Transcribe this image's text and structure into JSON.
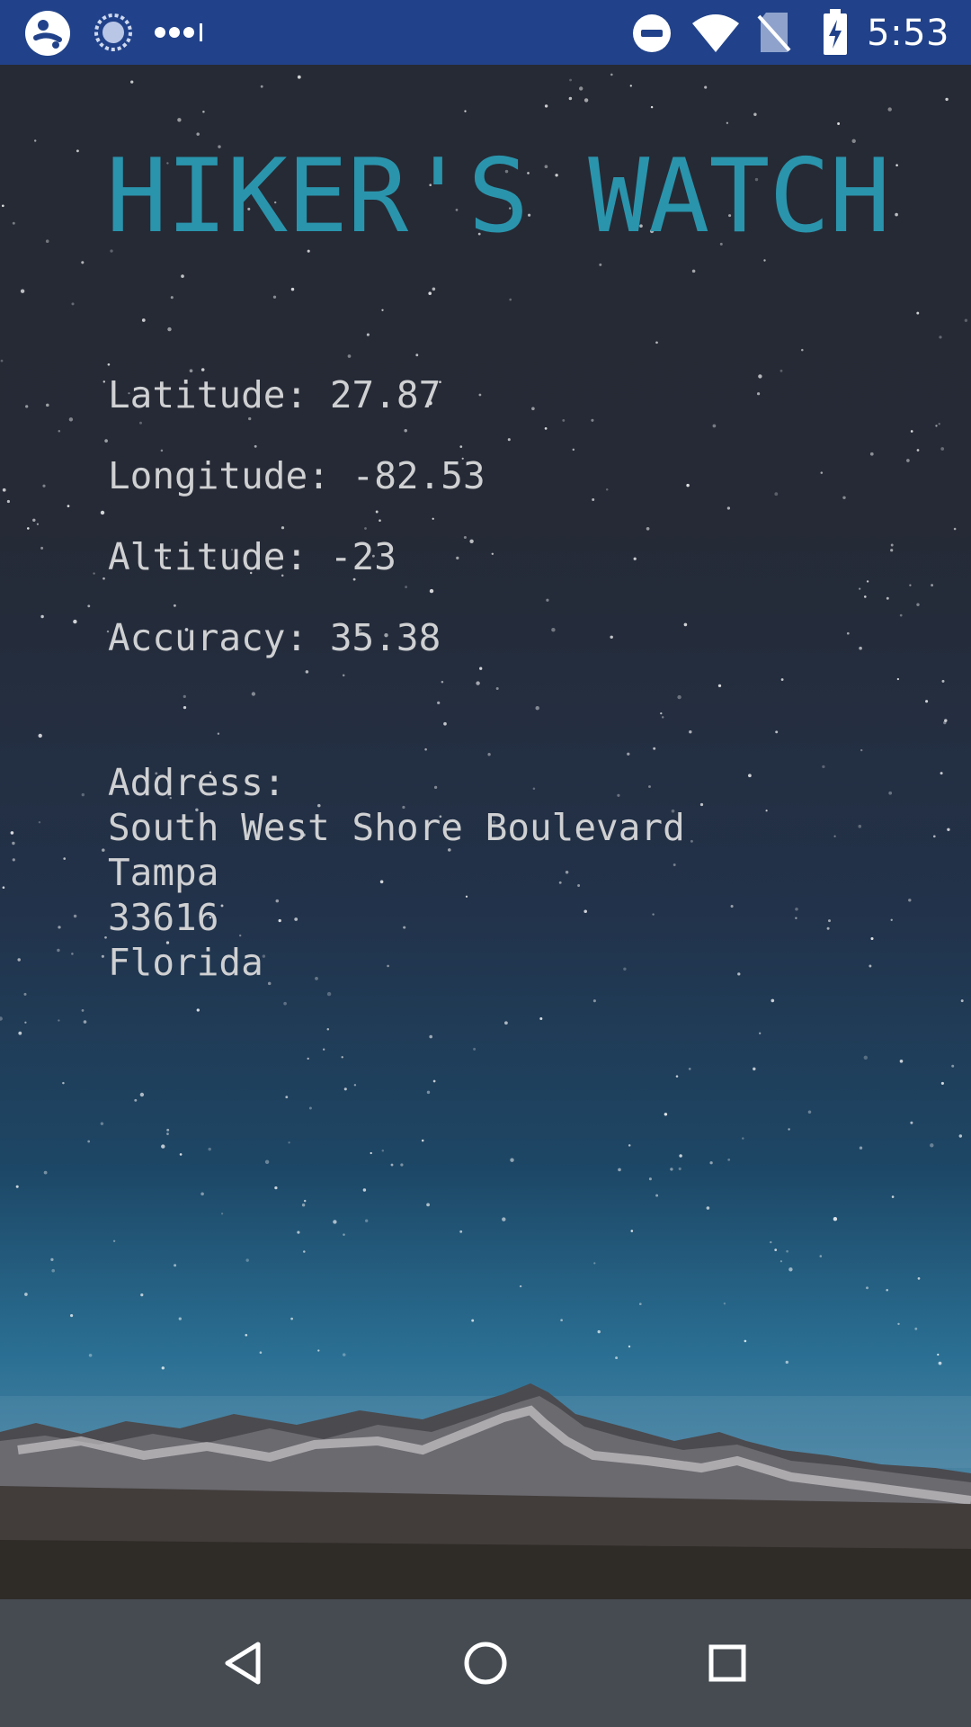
{
  "status_bar": {
    "time": "5:53",
    "icons": [
      "assistant-icon",
      "loading-icon",
      "more-dots-icon",
      "do-not-disturb-icon",
      "wifi-icon",
      "no-sim-icon",
      "battery-charging-icon"
    ]
  },
  "app": {
    "title": "HIKER'S WATCH",
    "latitude": "Latitude: 27.87",
    "longitude": "Longitude: -82.53",
    "altitude": "Altitude: -23",
    "accuracy": "Accuracy: 35.38",
    "address": {
      "label": "Address:",
      "lines": [
        "South West Shore Boulevard",
        "Tampa",
        "33616",
        "Florida"
      ]
    }
  },
  "nav_bar": {
    "buttons": [
      "back-icon",
      "home-icon",
      "recents-icon"
    ]
  },
  "colors": {
    "status_bar": "#21428a",
    "title": "#2a94ac",
    "text": "#cfd0d2",
    "nav_bar": "#454b51"
  }
}
